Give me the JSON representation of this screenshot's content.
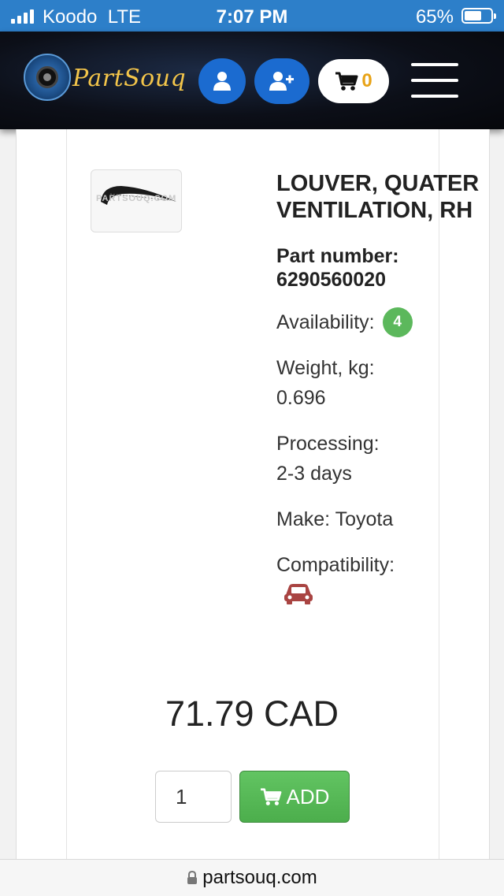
{
  "status_bar": {
    "carrier": "Koodo",
    "network": "LTE",
    "time": "7:07 PM",
    "battery_percent": "65%",
    "battery_level": 0.65,
    "signal_bars": 4
  },
  "header": {
    "logo_text": "PartSouq",
    "logo_badge_text": "PARTSOUQ",
    "icons": [
      "user-icon",
      "add-user-icon",
      "cart-icon",
      "hamburger-menu-icon"
    ],
    "cart_count": "0",
    "colors": {
      "button_blue": "#1b6bd0",
      "logo_gold": "#f3c54a",
      "cart_count": "#e8a317"
    }
  },
  "product": {
    "thumbnail_watermark": "PARTSOUQ.COM",
    "title": "LOUVER, QUATER VENTILATION, RH",
    "part_number_label": "Part number:",
    "part_number": "6290560020",
    "availability_label": "Availability:",
    "availability_count": "4",
    "weight_label": "Weight, kg:",
    "weight_value": "0.696",
    "processing_label": "Processing:",
    "processing_value": "2-3 days",
    "make_label": "Make:",
    "make_value": "Toyota",
    "compatibility_label": "Compatibility:",
    "compatibility_icon": "car-icon",
    "price": "71.79 CAD",
    "quantity": "1",
    "add_label": "ADD",
    "colors": {
      "availability_badge": "#5cb85c",
      "add_button": "#5cb85c",
      "car_icon": "#a94442"
    }
  },
  "browser": {
    "url": "partsouq.com",
    "icon": "lock-icon"
  }
}
